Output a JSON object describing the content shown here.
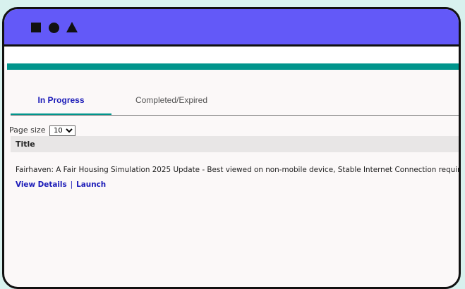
{
  "tabs": [
    {
      "label": "In Progress",
      "active": true
    },
    {
      "label": "Completed/Expired",
      "active": false
    }
  ],
  "page_size": {
    "label": "Page size",
    "selected": "10",
    "options": [
      "10"
    ]
  },
  "table": {
    "header_title": "Title",
    "rows": [
      {
        "title": "Fairhaven: A Fair Housing Simulation 2025 Update - Best viewed on non-mobile device, Stable Internet Connection required.",
        "view_details_label": "View Details",
        "separator": "|",
        "launch_label": "Launch"
      }
    ]
  },
  "colors": {
    "titlebar": "#6359f8",
    "accent_teal": "#00958c",
    "link": "#1a1ab8",
    "background": "#d8f1ee"
  },
  "icons": [
    "square-icon",
    "circle-icon",
    "triangle-icon"
  ]
}
